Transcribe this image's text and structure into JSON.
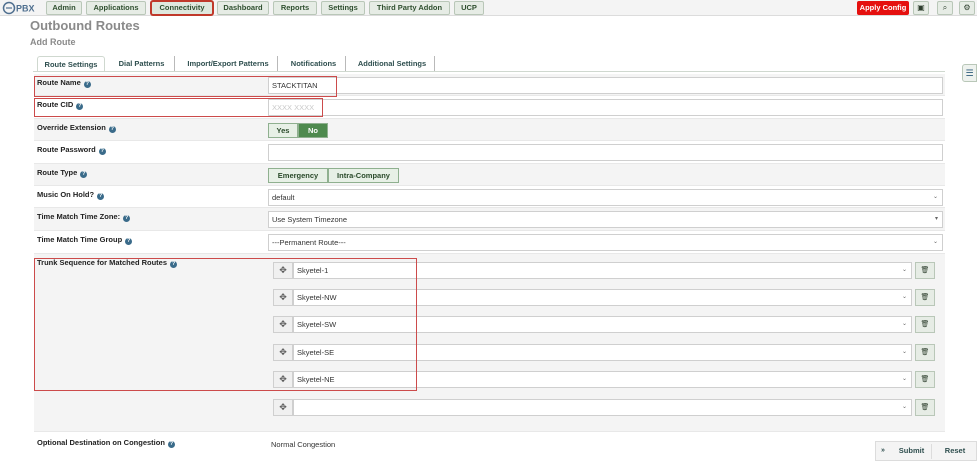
{
  "nav": {
    "logo": "FreePBX",
    "items": [
      {
        "label": "Admin"
      },
      {
        "label": "Applications"
      },
      {
        "label": "Connectivity"
      },
      {
        "label": "Dashboard"
      },
      {
        "label": "Reports"
      },
      {
        "label": "Settings"
      },
      {
        "label": "Third Party Addon"
      },
      {
        "label": "UCP"
      }
    ],
    "apply_config": "Apply Config",
    "icons": [
      "device-icon",
      "search-icon",
      "gear-icon"
    ]
  },
  "page": {
    "title": "Outbound Routes",
    "subtitle": "Add Route"
  },
  "tabs": [
    {
      "label": "Route Settings"
    },
    {
      "label": "Dial Patterns"
    },
    {
      "label": "Import/Export Patterns"
    },
    {
      "label": "Notifications"
    },
    {
      "label": "Additional Settings"
    }
  ],
  "form": {
    "route_name": {
      "label": "Route Name",
      "value": "STACKTITAN"
    },
    "route_cid": {
      "label": "Route CID",
      "value": "XXXX XXXX"
    },
    "override_extension": {
      "label": "Override Extension",
      "yes": "Yes",
      "no": "No"
    },
    "route_password": {
      "label": "Route Password",
      "value": ""
    },
    "route_type": {
      "label": "Route Type",
      "emergency": "Emergency",
      "intra": "Intra-Company"
    },
    "music_on_hold": {
      "label": "Music On Hold?",
      "value": "default"
    },
    "time_zone": {
      "label": "Time Match Time Zone:",
      "value": "Use System Timezone"
    },
    "time_group": {
      "label": "Time Match Time Group",
      "value": "---Permanent Route---"
    },
    "trunk_sequence": {
      "label": "Trunk Sequence for Matched Routes",
      "trunks": [
        "Skyetel-1",
        "Skyetel-NW",
        "Skyetel-SW",
        "Skyetel-SE",
        "Skyetel-NE",
        ""
      ]
    },
    "congestion": {
      "label": "Optional Destination on Congestion",
      "value": "Normal Congestion"
    }
  },
  "actions": {
    "submit": "Submit",
    "reset": "Reset"
  }
}
